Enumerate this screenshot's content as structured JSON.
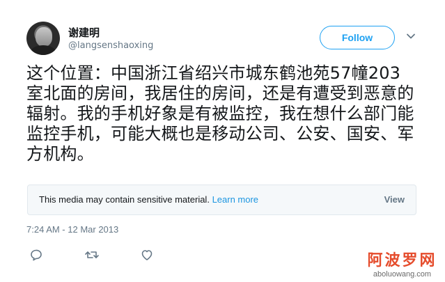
{
  "author": {
    "display_name": "谢建明",
    "handle": "@langsenshaoxing"
  },
  "follow_button": {
    "label": "Follow"
  },
  "tweet": {
    "text": "这个位置：中国浙江省绍兴市城东鹤池苑57幢203室北面的房间，我居住的房间，还是有遭受到恶意的辐射。我的手机好象是有被监控，我在想什么部门能监控手机，可能大概也是移动公司、公安、国安、军方机构。",
    "timestamp": "7:24 AM - 12 Mar 2013"
  },
  "media_warning": {
    "message": "This media may contain sensitive material.",
    "link": "Learn more",
    "view_label": "View"
  },
  "actions": {
    "icons": [
      "reply-icon",
      "retweet-icon",
      "like-icon"
    ]
  },
  "watermark": {
    "cn": "阿波罗网",
    "url": "aboluowang.com"
  },
  "colors": {
    "accent": "#1da1f2",
    "link": "#1b95e0",
    "secondary_text": "#657786",
    "watermark_red": "#e54c2c"
  }
}
